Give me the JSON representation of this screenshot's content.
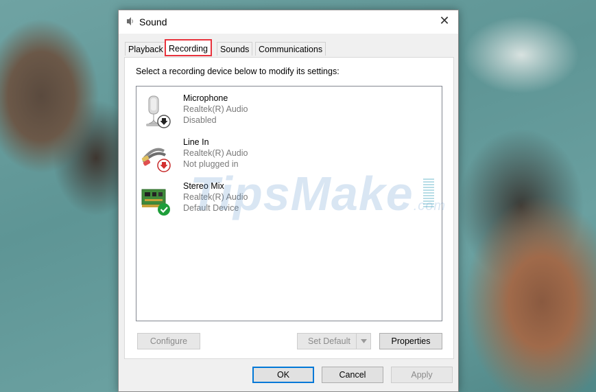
{
  "window": {
    "title": "Sound",
    "close_glyph": "✕"
  },
  "tabs": [
    {
      "label": "Playback",
      "active": false
    },
    {
      "label": "Recording",
      "active": true
    },
    {
      "label": "Sounds",
      "active": false
    },
    {
      "label": "Communications",
      "active": false
    }
  ],
  "recording": {
    "instruction": "Select a recording device below to modify its settings:",
    "devices": [
      {
        "name": "Microphone",
        "driver": "Realtek(R) Audio",
        "status": "Disabled",
        "badge": "down-arrow-icon"
      },
      {
        "name": "Line In",
        "driver": "Realtek(R) Audio",
        "status": "Not plugged in",
        "badge": "red-down-arrow-icon"
      },
      {
        "name": "Stereo Mix",
        "driver": "Realtek(R) Audio",
        "status": "Default Device",
        "badge": "green-check-icon"
      }
    ]
  },
  "panel_buttons": {
    "configure": "Configure",
    "set_default": "Set Default",
    "properties": "Properties"
  },
  "dialog_buttons": {
    "ok": "OK",
    "cancel": "Cancel",
    "apply": "Apply"
  },
  "watermark": {
    "main": "TipsMake",
    "suffix": ".com"
  },
  "colors": {
    "tab_highlight": "#e8323c",
    "accent": "#0078d7",
    "check_green": "#1e9e3a"
  }
}
